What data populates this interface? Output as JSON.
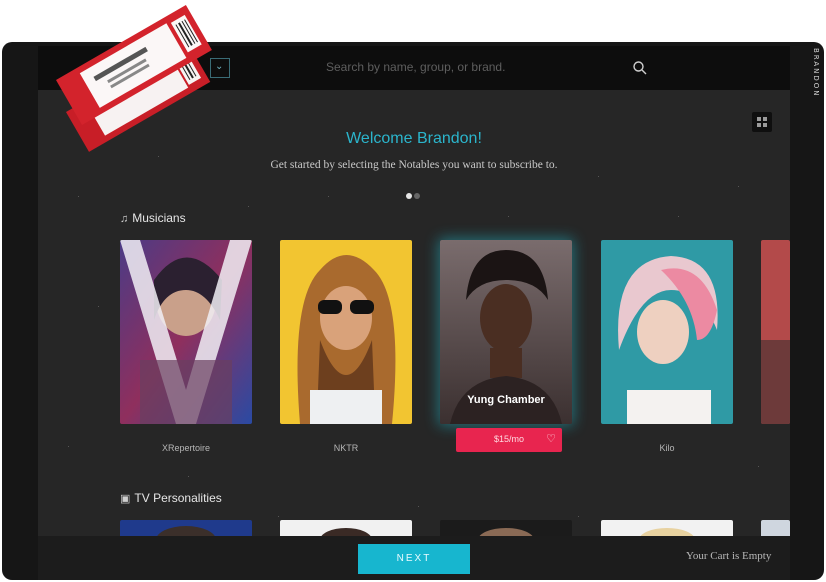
{
  "sidebar": {
    "user_label": "BRANDON"
  },
  "header": {
    "search_placeholder": "Search by name, group, or brand.",
    "search_icon": "search-icon",
    "dropdown_icon": "chevron-down-icon"
  },
  "toolbar": {
    "grid_icon": "grid-view-icon"
  },
  "main": {
    "welcome_title": "Welcome Brandon!",
    "subtitle": "Get started by selecting the Notables you want to subscribe to.",
    "carousel": {
      "active_page": 1,
      "total_pages": 2
    },
    "sections": [
      {
        "title": "Musicians",
        "icon": "music-note-icon",
        "cards": [
          {
            "name": "XRepertoire"
          },
          {
            "name": "NKTR"
          },
          {
            "name": "Yung Chamber",
            "price": "$15/mo",
            "featured": true
          },
          {
            "name": "Kilo"
          }
        ]
      },
      {
        "title": "TV Personalities",
        "icon": "tv-icon"
      }
    ]
  },
  "footer": {
    "next_label": "NEXT",
    "cart_status": "Your Cart is Empty"
  },
  "colors": {
    "accent": "#17b6cf",
    "price": "#e8254f",
    "background": "#262626"
  }
}
